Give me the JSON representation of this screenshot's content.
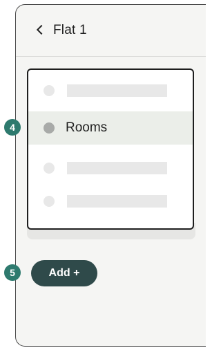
{
  "header": {
    "title": "Flat 1"
  },
  "list": {
    "items": [
      {
        "label": "",
        "placeholder": true
      },
      {
        "label": "Rooms",
        "placeholder": false
      },
      {
        "label": "",
        "placeholder": true
      },
      {
        "label": "",
        "placeholder": true
      }
    ]
  },
  "actions": {
    "add_label": "Add +"
  },
  "annotations": {
    "list_badge": "4",
    "add_badge": "5"
  },
  "colors": {
    "button_bg": "#2f4a4a",
    "badge_bg": "#2e7a6e",
    "selected_row_bg": "#ebeee9"
  }
}
